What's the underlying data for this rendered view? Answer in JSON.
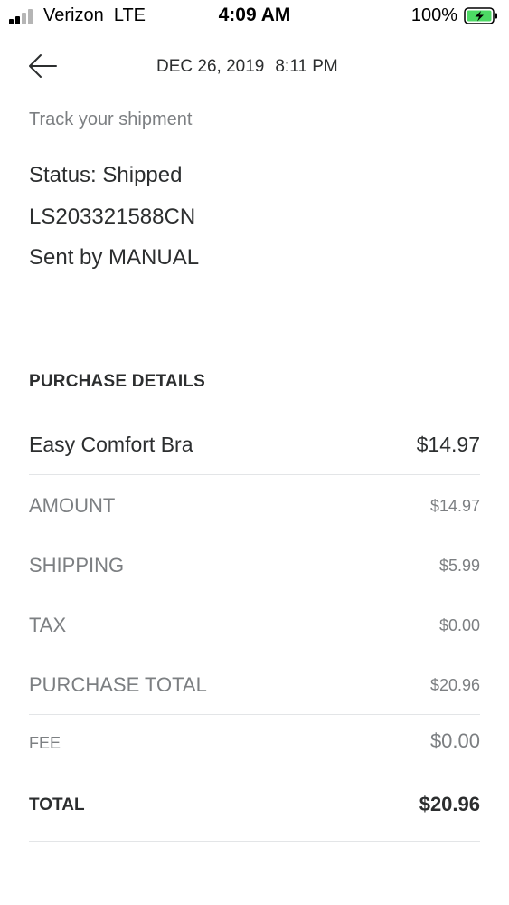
{
  "status_bar": {
    "carrier": "Verizon  LTE",
    "time": "4:09 AM",
    "battery": "100%",
    "signal_bars_active": 2,
    "signal_bars_total": 4,
    "battery_level": 1.0,
    "battery_charging": true
  },
  "header": {
    "back_icon": "arrow-left-icon",
    "date": "DEC 26, 2019",
    "time": "8:11 PM"
  },
  "shipment": {
    "track_label": "Track your shipment",
    "status": "Status: Shipped",
    "tracking_number": "LS203321588CN",
    "sent_by": "Sent by MANUAL"
  },
  "purchase": {
    "title": "PURCHASE DETAILS",
    "item": {
      "label": "Easy Comfort Bra",
      "value": "$14.97"
    },
    "amount": {
      "label": "AMOUNT",
      "value": "$14.97"
    },
    "shipping": {
      "label": "SHIPPING",
      "value": "$5.99"
    },
    "tax": {
      "label": "TAX",
      "value": "$0.00"
    },
    "purchase_total": {
      "label": "PURCHASE TOTAL",
      "value": "$20.96"
    },
    "fee": {
      "label": "FEE",
      "value": "$0.00"
    },
    "total": {
      "label": "TOTAL",
      "value": "$20.96"
    }
  },
  "colors": {
    "text_primary": "#2c2e2f",
    "text_secondary": "#7c7f82",
    "divider": "#e3e5e7",
    "battery_green": "#4cd964"
  }
}
